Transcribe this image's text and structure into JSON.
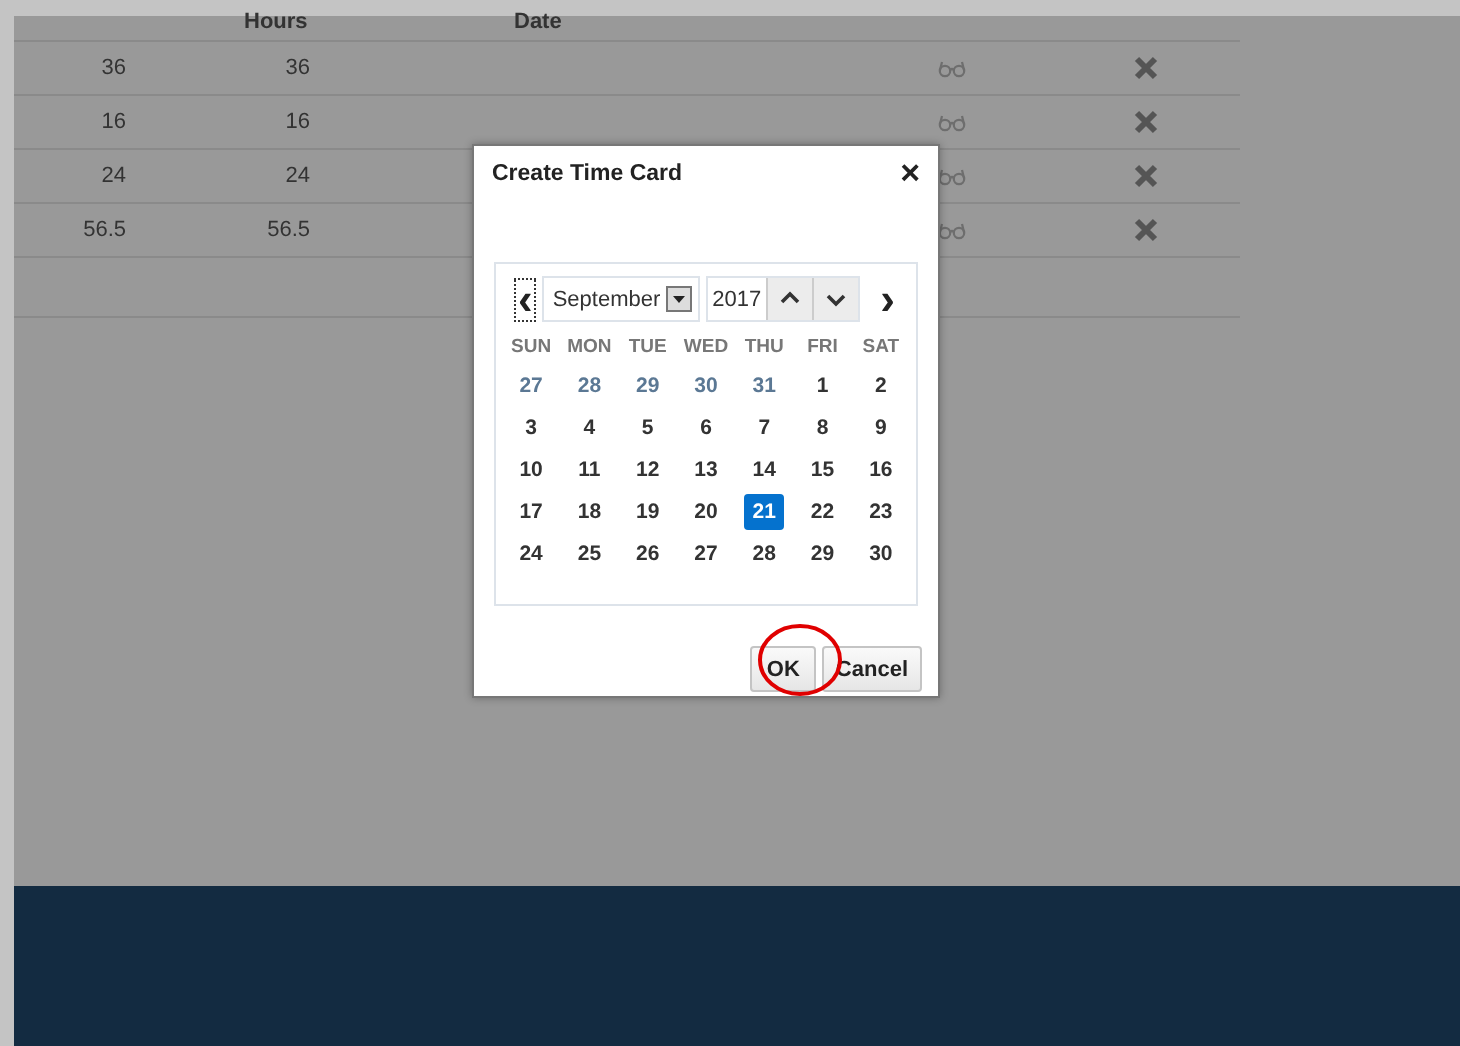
{
  "table": {
    "columns": [
      "Hours",
      "Date"
    ],
    "rows": [
      {
        "column_1": "36",
        "hours": "36"
      },
      {
        "column_1": "16",
        "hours": "16"
      },
      {
        "column_1": "24",
        "hours": "24"
      },
      {
        "column_1": "56.5",
        "hours": "56.5"
      }
    ]
  },
  "dialog": {
    "title": "Create Time Card",
    "close": "×",
    "calendar": {
      "prev": "‹",
      "next": "›",
      "month": "September",
      "year": "2017",
      "weekdays": [
        "SUN",
        "MON",
        "TUE",
        "WED",
        "THU",
        "FRI",
        "SAT"
      ],
      "days": [
        {
          "day": "27",
          "other_month": true,
          "selected": false
        },
        {
          "day": "28",
          "other_month": true,
          "selected": false
        },
        {
          "day": "29",
          "other_month": true,
          "selected": false
        },
        {
          "day": "30",
          "other_month": true,
          "selected": false
        },
        {
          "day": "31",
          "other_month": true,
          "selected": false
        },
        {
          "day": "1",
          "other_month": false,
          "selected": false
        },
        {
          "day": "2",
          "other_month": false,
          "selected": false
        },
        {
          "day": "3",
          "other_month": false,
          "selected": false
        },
        {
          "day": "4",
          "other_month": false,
          "selected": false
        },
        {
          "day": "5",
          "other_month": false,
          "selected": false
        },
        {
          "day": "6",
          "other_month": false,
          "selected": false
        },
        {
          "day": "7",
          "other_month": false,
          "selected": false
        },
        {
          "day": "8",
          "other_month": false,
          "selected": false
        },
        {
          "day": "9",
          "other_month": false,
          "selected": false
        },
        {
          "day": "10",
          "other_month": false,
          "selected": false
        },
        {
          "day": "11",
          "other_month": false,
          "selected": false
        },
        {
          "day": "12",
          "other_month": false,
          "selected": false
        },
        {
          "day": "13",
          "other_month": false,
          "selected": false
        },
        {
          "day": "14",
          "other_month": false,
          "selected": false
        },
        {
          "day": "15",
          "other_month": false,
          "selected": false
        },
        {
          "day": "16",
          "other_month": false,
          "selected": false
        },
        {
          "day": "17",
          "other_month": false,
          "selected": false
        },
        {
          "day": "18",
          "other_month": false,
          "selected": false
        },
        {
          "day": "19",
          "other_month": false,
          "selected": false
        },
        {
          "day": "20",
          "other_month": false,
          "selected": false
        },
        {
          "day": "21",
          "other_month": false,
          "selected": true
        },
        {
          "day": "22",
          "other_month": false,
          "selected": false
        },
        {
          "day": "23",
          "other_month": false,
          "selected": false
        },
        {
          "day": "24",
          "other_month": false,
          "selected": false
        },
        {
          "day": "25",
          "other_month": false,
          "selected": false
        },
        {
          "day": "26",
          "other_month": false,
          "selected": false
        },
        {
          "day": "27",
          "other_month": false,
          "selected": false
        },
        {
          "day": "28",
          "other_month": false,
          "selected": false
        },
        {
          "day": "29",
          "other_month": false,
          "selected": false
        },
        {
          "day": "30",
          "other_month": false,
          "selected": false
        }
      ]
    },
    "buttons": [
      "OK",
      "Cancel"
    ]
  }
}
